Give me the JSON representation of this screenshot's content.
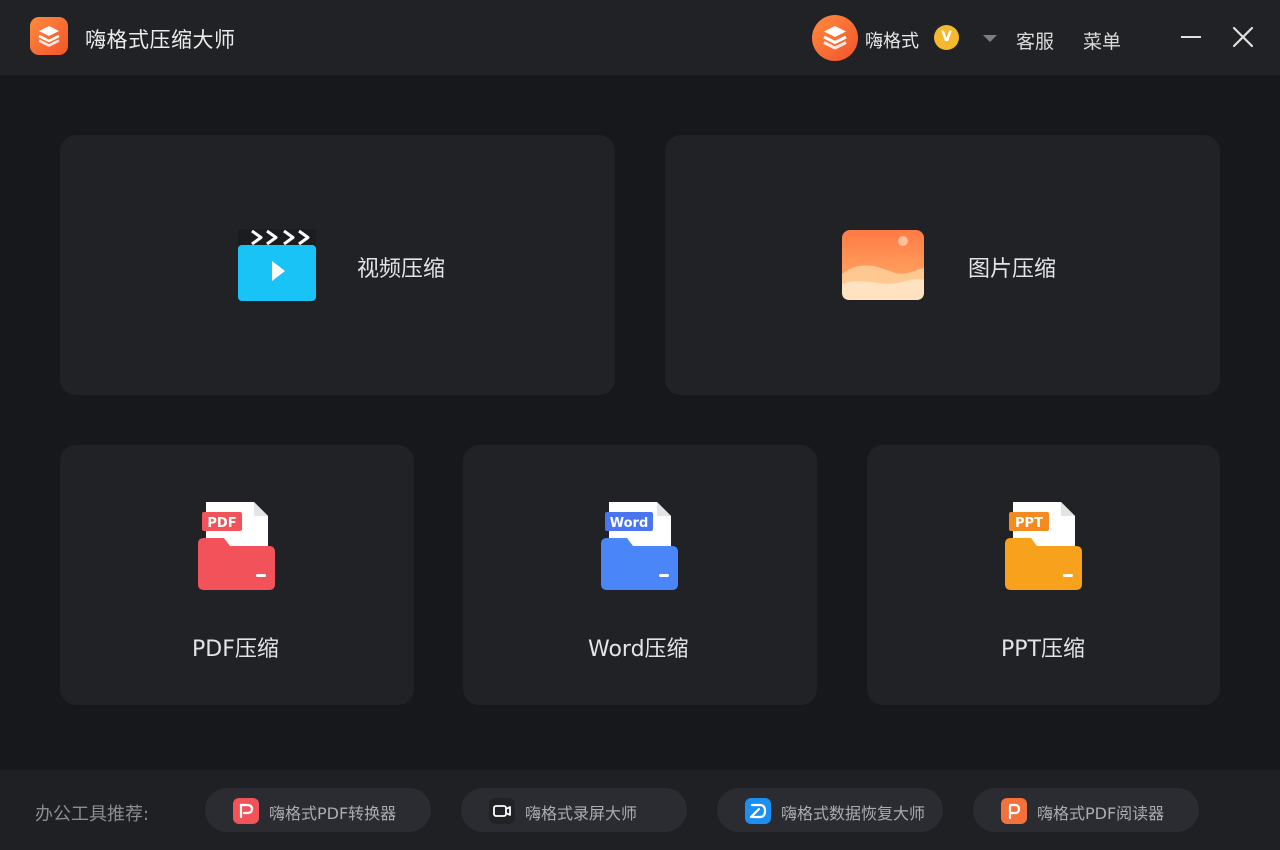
{
  "app": {
    "title": "嗨格式压缩大师"
  },
  "header": {
    "username": "嗨格式",
    "vip_badge": "V",
    "support_label": "客服",
    "menu_label": "菜单"
  },
  "cards": {
    "video": {
      "label": "视频压缩"
    },
    "image": {
      "label": "图片压缩"
    },
    "pdf": {
      "label": "PDF压缩",
      "tag": "PDF"
    },
    "word": {
      "label": "Word压缩",
      "tag": "Word"
    },
    "ppt": {
      "label": "PPT压缩",
      "tag": "PPT"
    }
  },
  "footer": {
    "recommend_label": "办公工具推荐:",
    "tools": [
      {
        "label": "嗨格式PDF转换器",
        "icon": "pdf-converter-icon"
      },
      {
        "label": "嗨格式录屏大师",
        "icon": "screen-recorder-icon"
      },
      {
        "label": "嗨格式数据恢复大师",
        "icon": "data-recovery-icon"
      },
      {
        "label": "嗨格式PDF阅读器",
        "icon": "pdf-reader-icon"
      }
    ]
  },
  "colors": {
    "background": "#16181b",
    "panel": "#202226",
    "brand_orange": "#f2542d",
    "pdf_red": "#f2535a",
    "word_blue": "#4a86f7",
    "ppt_orange": "#f7a11d",
    "video_cyan": "#19c3f5"
  }
}
